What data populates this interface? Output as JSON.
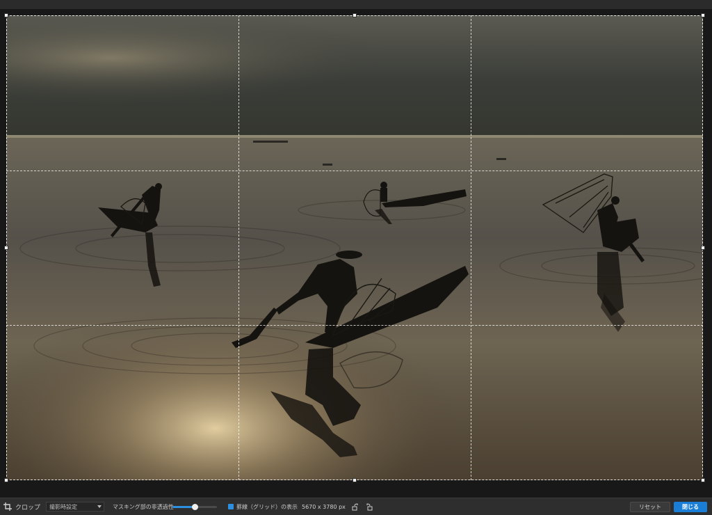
{
  "editor": {
    "photo_description_icon": "photo-canvas"
  },
  "toolbar": {
    "crop_icon": "crop-icon",
    "crop_label": "クロップ",
    "aspect_value": "撮影時設定",
    "mask_opacity_label": "マスキング部の非透過性",
    "mask_opacity_level": 0.5,
    "grid_checkbox_checked": true,
    "grid_label": "罫線（グリッド）の表示",
    "image_size": "5670 x 3780 px",
    "rotate_left_icon": "rotate-left-icon",
    "rotate_right_icon": "rotate-right-icon",
    "reset_label": "リセット",
    "close_label": "閉じる",
    "accent_color": "#1a7ed6"
  }
}
